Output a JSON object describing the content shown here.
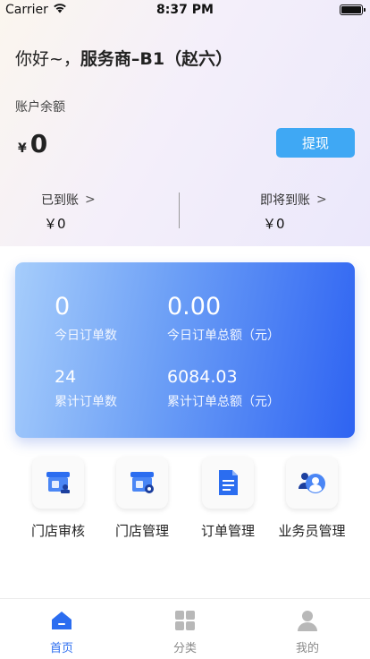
{
  "status": {
    "carrier": "Carrier",
    "time": "8:37 PM"
  },
  "greeting": {
    "prefix": "你好~，",
    "name": "服务商–B1（赵六）"
  },
  "account": {
    "balance_label": "账户余额",
    "currency": "¥",
    "balance": "0",
    "withdraw_label": "提现"
  },
  "settle": {
    "arrived_label": "已到账",
    "arrived_amount": "￥0",
    "pending_label": "即将到账",
    "pending_amount": "￥0",
    "chevron": ">"
  },
  "stats": {
    "today_orders_value": "0",
    "today_orders_label": "今日订单数",
    "today_amount_value": "0.00",
    "today_amount_label": "今日订单总额（元）",
    "total_orders_value": "24",
    "total_orders_label": "累计订单数",
    "total_amount_value": "6084.03",
    "total_amount_label": "累计订单总额（元）"
  },
  "shortcuts": [
    {
      "label": "门店审核",
      "icon": "store-review-icon"
    },
    {
      "label": "门店管理",
      "icon": "store-manage-icon"
    },
    {
      "label": "订单管理",
      "icon": "order-document-icon"
    },
    {
      "label": "业务员管理",
      "icon": "salesperson-group-icon"
    }
  ],
  "tabs": [
    {
      "label": "首页",
      "icon": "home-icon",
      "active": true
    },
    {
      "label": "分类",
      "icon": "category-grid-icon",
      "active": false
    },
    {
      "label": "我的",
      "icon": "user-profile-icon",
      "active": false
    }
  ],
  "colors": {
    "accent": "#3fa8f4",
    "tab_active": "#2b6df0",
    "card_gradient_start": "#a6cdfb",
    "card_gradient_end": "#2e63f2"
  }
}
